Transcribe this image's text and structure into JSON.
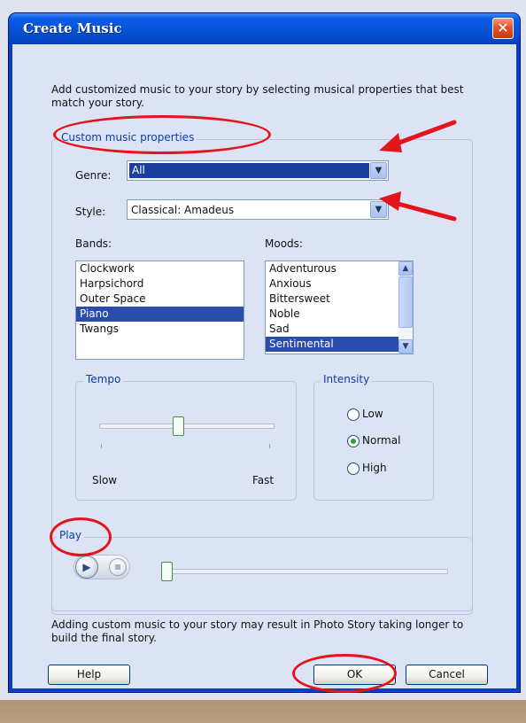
{
  "dialog": {
    "title": "Create Music",
    "close_glyph": "✕",
    "intro": "Add customized music to your story by selecting musical properties that best match your story.",
    "footer_note": "Adding custom music to your story may result in Photo Story taking longer to build the final story."
  },
  "custom_props": {
    "legend": "Custom music properties",
    "genre": {
      "label": "Genre:",
      "value": "All"
    },
    "style": {
      "label": "Style:",
      "value": "Classical: Amadeus"
    },
    "bands": {
      "label": "Bands:",
      "items": [
        "Clockwork",
        "Harpsichord",
        "Outer Space",
        "Piano",
        "Twangs"
      ],
      "selected": "Piano"
    },
    "moods": {
      "label": "Moods:",
      "items": [
        "Adventurous",
        "Anxious",
        "Bittersweet",
        "Noble",
        "Sad",
        "Sentimental"
      ],
      "selected": "Sentimental"
    }
  },
  "tempo": {
    "legend": "Tempo",
    "min_label": "Slow",
    "max_label": "Fast",
    "level": 0.45
  },
  "intensity": {
    "legend": "Intensity",
    "options": [
      "Low",
      "Normal",
      "High"
    ],
    "selected": "Normal"
  },
  "play": {
    "legend": "Play",
    "position": 0.0
  },
  "buttons": {
    "help": "Help",
    "ok": "OK",
    "cancel": "Cancel"
  },
  "icons": {
    "close": "close-icon",
    "dropdown": "chevron-down-icon",
    "play": "play-icon",
    "stop": "stop-icon"
  },
  "colors": {
    "titlebar": "#0653d8",
    "dialog_bg": "#dbe3f5",
    "selection": "#2a4dab",
    "annotation": "#e3151b"
  }
}
